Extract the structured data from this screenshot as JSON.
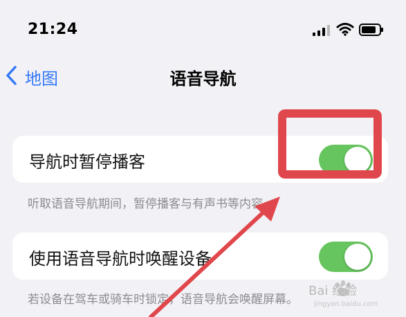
{
  "status_bar": {
    "time": "21:24"
  },
  "nav": {
    "back_label": "地图",
    "title": "语音导航"
  },
  "settings": [
    {
      "label": "导航时暂停播客",
      "enabled": true,
      "description": "听取语音导航期间，暂停播客与有声书等内容。"
    },
    {
      "label": "使用语音导航时唤醒设备",
      "enabled": true,
      "description": "若设备在驾车或骑车时锁定，语音导航会唤醒屏幕。"
    }
  ],
  "colors": {
    "accent": "#3478f6",
    "toggle_on": "#66c55e",
    "annotation": "#e0474c",
    "background": "#f2f2f6"
  },
  "icons": [
    "signal-icon",
    "wifi-icon",
    "battery-icon",
    "back-chevron-icon"
  ],
  "watermark": {
    "brand": "Bai 经验",
    "url": "jingyan.baidu.com"
  }
}
